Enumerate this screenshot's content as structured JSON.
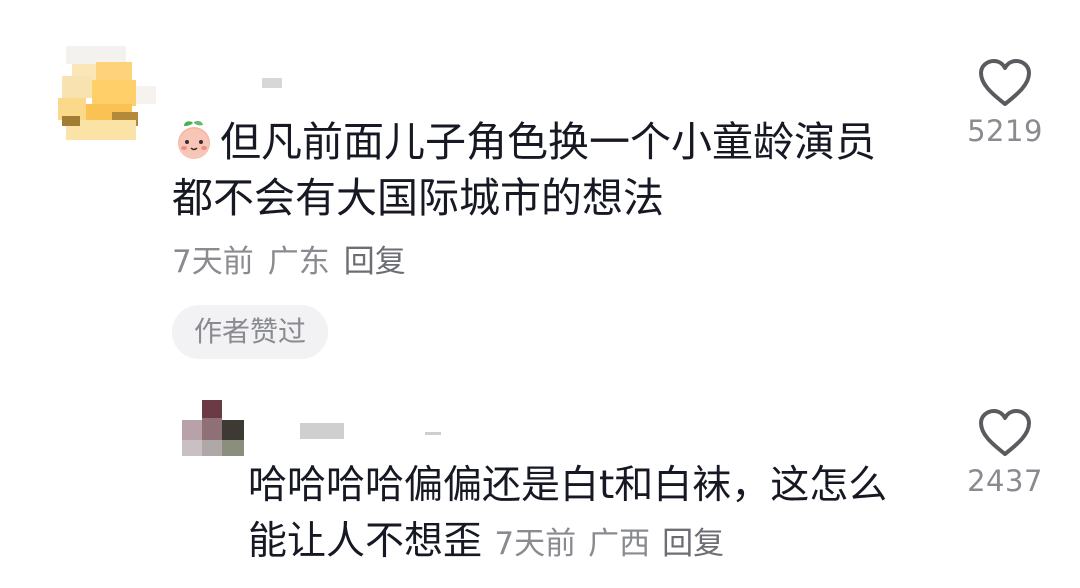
{
  "comment": {
    "text": "但凡前面儿子角色换一个小童龄演员都不会有大国际城市的想法",
    "emoji": "peach-emoji",
    "time": "7天前",
    "location": "广东",
    "reply_label": "回复",
    "author_liked_label": "作者赞过",
    "like_count": "5219"
  },
  "reply": {
    "text": "哈哈哈哈偏偏还是白t和白袜，这怎么能让人不想歪",
    "time": "7天前",
    "location": "广西",
    "reply_label": "回复",
    "like_count": "2437"
  },
  "colors": {
    "text": "#161823",
    "meta": "#8a8b91",
    "heart": "#5a5a5f"
  }
}
